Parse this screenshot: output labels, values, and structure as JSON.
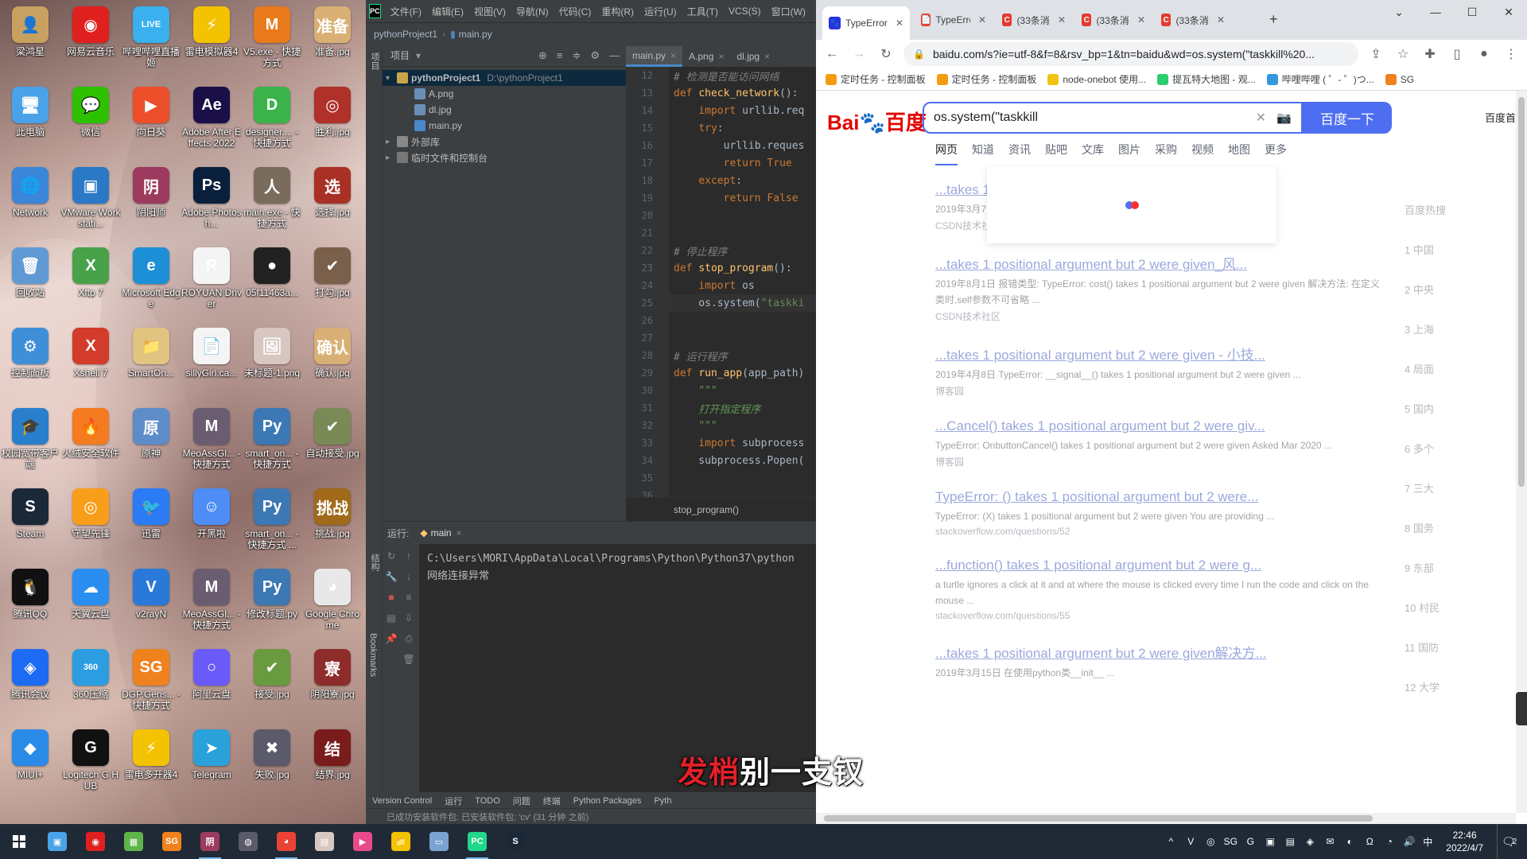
{
  "desktop": {
    "icons": [
      {
        "label": "梁鸿星",
        "color": "#c8a060",
        "glyph": "👤"
      },
      {
        "label": "网易云音乐",
        "color": "#e0201f",
        "glyph": "◉"
      },
      {
        "label": "哔哩哔哩直播姬",
        "color": "#3ab0ee",
        "glyph": "LIVE"
      },
      {
        "label": "雷电模拟器4",
        "color": "#f3c200",
        "glyph": "⚡"
      },
      {
        "label": "V5.exe - 快捷方式",
        "color": "#e87a1c",
        "glyph": "M"
      },
      {
        "label": "准备.jpg",
        "color": "#d8b076",
        "glyph": "准备"
      },
      {
        "label": "此电脑",
        "color": "#4aa3e8",
        "glyph": "🖥"
      },
      {
        "label": "微信",
        "color": "#2dc100",
        "glyph": "💬"
      },
      {
        "label": "向日葵",
        "color": "#ec4f2a",
        "glyph": "▶"
      },
      {
        "label": "Adobe After Effects 2022",
        "color": "#1b0f48",
        "glyph": "Ae"
      },
      {
        "label": "designer.... - 快捷方式",
        "color": "#3bb34a",
        "glyph": "D"
      },
      {
        "label": "胜利.jpg",
        "color": "#b0302a",
        "glyph": "◎"
      },
      {
        "label": "Network",
        "color": "#3a86d8",
        "glyph": "🌐"
      },
      {
        "label": "VMware Workstati...",
        "color": "#2b78c6",
        "glyph": "▣"
      },
      {
        "label": "阴阳师",
        "color": "#9c3b5e",
        "glyph": "阴"
      },
      {
        "label": "Adobe Photosh...",
        "color": "#0a1f3b",
        "glyph": "Ps"
      },
      {
        "label": "main.exe - 快捷方式",
        "color": "#7a6c5c",
        "glyph": "人"
      },
      {
        "label": "选择.jpg",
        "color": "#a83024",
        "glyph": "选"
      },
      {
        "label": "回收站",
        "color": "#5f9ad4",
        "glyph": "🗑"
      },
      {
        "label": "Xftp 7",
        "color": "#47a24a",
        "glyph": "X"
      },
      {
        "label": "Microsoft Edge",
        "color": "#1d8fd6",
        "glyph": "e"
      },
      {
        "label": "ROYUAN Driver",
        "color": "#f4f4f4",
        "glyph": "R"
      },
      {
        "label": "05f11463a...",
        "color": "#222222",
        "glyph": "●"
      },
      {
        "label": "打勾.jpg",
        "color": "#7a5f4a",
        "glyph": "✔"
      },
      {
        "label": "控制面板",
        "color": "#3f8fd8",
        "glyph": "⚙"
      },
      {
        "label": "Xshell 7",
        "color": "#d33b2a",
        "glyph": "X"
      },
      {
        "label": "SmartOn...",
        "color": "#e0c480",
        "glyph": "📁"
      },
      {
        "label": "sillyGirl.ca...",
        "color": "#f4f4f4",
        "glyph": "📄"
      },
      {
        "label": "未标题-1.png",
        "color": "#d7c7c0",
        "glyph": "🖼"
      },
      {
        "label": "确认.jpg",
        "color": "#d8b076",
        "glyph": "确认"
      },
      {
        "label": "校园宽带客户端",
        "color": "#2a7fcc",
        "glyph": "🎓"
      },
      {
        "label": "火绒安全软件",
        "color": "#f47b20",
        "glyph": "🔥"
      },
      {
        "label": "原神",
        "color": "#5d8cc9",
        "glyph": "原"
      },
      {
        "label": "MeoAssGl... - 快捷方式",
        "color": "#6a5d72",
        "glyph": "M"
      },
      {
        "label": "smart_on... - 快捷方式",
        "color": "#3c78b4",
        "glyph": "Py"
      },
      {
        "label": "自动接受.jpg",
        "color": "#7a8a56",
        "glyph": "✔"
      },
      {
        "label": "Steam",
        "color": "#1b2838",
        "glyph": "S"
      },
      {
        "label": "守望先锋",
        "color": "#f99e1a",
        "glyph": "◎"
      },
      {
        "label": "迅雷",
        "color": "#2b7bf5",
        "glyph": "🐦"
      },
      {
        "label": "开黑啦",
        "color": "#4e8df5",
        "glyph": "☺"
      },
      {
        "label": "smart_on... - 快捷方式 ...",
        "color": "#3c78b4",
        "glyph": "Py"
      },
      {
        "label": "挑战.jpg",
        "color": "#a06a1a",
        "glyph": "挑战"
      },
      {
        "label": "腾讯QQ",
        "color": "#111111",
        "glyph": "🐧"
      },
      {
        "label": "天翼云盘",
        "color": "#2a8ef0",
        "glyph": "☁"
      },
      {
        "label": "v2rayN",
        "color": "#2a78d8",
        "glyph": "V"
      },
      {
        "label": "MeoAssGl... - 快捷方式",
        "color": "#6a5d72",
        "glyph": "M"
      },
      {
        "label": "修改标题.py",
        "color": "#3c78b4",
        "glyph": "Py"
      },
      {
        "label": "Google Chrome",
        "color": "#e8e8e8",
        "glyph": "◕"
      },
      {
        "label": "腾讯会议",
        "color": "#1d6bf2",
        "glyph": "◈"
      },
      {
        "label": "360压缩",
        "color": "#2c9de0",
        "glyph": "360"
      },
      {
        "label": "DGP.Gens... - 快捷方式",
        "color": "#f0821e",
        "glyph": "SG"
      },
      {
        "label": "阿里云盘",
        "color": "#6a5af9",
        "glyph": "○"
      },
      {
        "label": "接受.jpg",
        "color": "#6a9a40",
        "glyph": "✔"
      },
      {
        "label": "阴阳寮.jpg",
        "color": "#8e2c2c",
        "glyph": "寮"
      },
      {
        "label": "MIUI+",
        "color": "#2a8ae8",
        "glyph": "◆"
      },
      {
        "label": "Logitech G HUB",
        "color": "#111111",
        "glyph": "G"
      },
      {
        "label": "雷电多开器4",
        "color": "#f3c200",
        "glyph": "⚡"
      },
      {
        "label": "Telegram",
        "color": "#2aa1da",
        "glyph": "➤"
      },
      {
        "label": "失败.jpg",
        "color": "#5a5a6a",
        "glyph": "✖"
      },
      {
        "label": "结界.jpg",
        "color": "#7a1c1c",
        "glyph": "结"
      }
    ]
  },
  "ide": {
    "menu": [
      "文件(F)",
      "编辑(E)",
      "视图(V)",
      "导航(N)",
      "代码(C)",
      "重构(R)",
      "运行(U)",
      "工具(T)",
      "VCS(S)",
      "窗口(W)"
    ],
    "logo": "PC",
    "breadcrumb": {
      "project": "pythonProject1",
      "file": "main.py"
    },
    "left_strip": {
      "project": "项目",
      "structure": "结构",
      "bookmarks": "Bookmarks"
    },
    "project_panel": {
      "title": "项目",
      "root": "pythonProject1",
      "root_path": "D:\\pythonProject1",
      "files": [
        "A.png",
        "dl.jpg",
        "main.py"
      ],
      "external": "外部库",
      "scratches": "临时文件和控制台"
    },
    "editor_tabs": [
      "main.py",
      "A.png",
      "dl.jpg"
    ],
    "code_lines": [
      {
        "n": "12",
        "html": "<span class='cm'># 检测是否能访问网络</span>"
      },
      {
        "n": "13",
        "html": "<span class='k'>def</span> <span class='fn'>check_network</span>():"
      },
      {
        "n": "14",
        "html": "    <span class='k'>import</span> urllib.req"
      },
      {
        "n": "15",
        "html": "    <span class='k'>try</span>:"
      },
      {
        "n": "16",
        "html": "        urllib.reques"
      },
      {
        "n": "17",
        "html": "        <span class='k'>return</span> <span class='k'>True</span>"
      },
      {
        "n": "18",
        "html": "    <span class='k'>except</span>:"
      },
      {
        "n": "19",
        "html": "        <span class='k'>return</span> <span class='k'>False</span>"
      },
      {
        "n": "20",
        "html": ""
      },
      {
        "n": "21",
        "html": ""
      },
      {
        "n": "22",
        "html": "<span class='cm'># 停止程序</span>"
      },
      {
        "n": "23",
        "html": "<span class='k'>def</span> <span class='fn'>stop_program</span>():"
      },
      {
        "n": "24",
        "html": "    <span class='k'>import</span> os"
      },
      {
        "n": "25",
        "html": "    os.system(<span class='st'>\"taskki</span>"
      },
      {
        "n": "26",
        "html": ""
      },
      {
        "n": "27",
        "html": ""
      },
      {
        "n": "28",
        "html": "<span class='cm'># 运行程序</span>"
      },
      {
        "n": "29",
        "html": "<span class='k'>def</span> <span class='fn'>run_app</span>(app_path)"
      },
      {
        "n": "30",
        "html": "    <span class='doc'>\"\"\"</span>"
      },
      {
        "n": "31",
        "html": "    <span class='doc'>打开指定程序</span>"
      },
      {
        "n": "32",
        "html": "    <span class='doc'>\"\"\"</span>"
      },
      {
        "n": "33",
        "html": "    <span class='k'>import</span> subprocess"
      },
      {
        "n": "34",
        "html": "    subprocess.Popen("
      },
      {
        "n": "35",
        "html": ""
      },
      {
        "n": "36",
        "html": ""
      }
    ],
    "current_line": "25",
    "code_crumb": "stop_program()",
    "run": {
      "label": "运行:",
      "config": "main",
      "output": [
        "C:\\Users\\MORI\\AppData\\Local\\Programs\\Python\\Python37\\python",
        "网络连接异常"
      ]
    },
    "bottom_tools": [
      "Version Control",
      "运行",
      "TODO",
      "问题",
      "终端",
      "Python Packages",
      "Pyth"
    ],
    "status": "已成功安装软件包: 已安装软件包: 'cv' (31 分钟 之前)"
  },
  "chrome": {
    "tabs": [
      {
        "title": "TypeError:",
        "color": "#2932e1",
        "glyph": "🐾",
        "active": true
      },
      {
        "title": "TypeError:",
        "color": "#e8412c",
        "glyph": "📄",
        "active": false
      },
      {
        "title": "(33条消息",
        "color": "#e33b2e",
        "glyph": "C",
        "active": false
      },
      {
        "title": "(33条消息",
        "color": "#e33b2e",
        "glyph": "C",
        "active": false
      },
      {
        "title": "(33条消息",
        "color": "#e33b2e",
        "glyph": "C",
        "active": false
      }
    ],
    "url": "baidu.com/s?ie=utf-8&f=8&rsv_bp=1&tn=baidu&wd=os.system(\"taskkill%20...",
    "bookmarks": [
      {
        "label": "定时任务 - 控制面板",
        "color": "#f39c12"
      },
      {
        "label": "定时任务 - 控制面板",
        "color": "#f39c12"
      },
      {
        "label": "node-onebot 使用...",
        "color": "#f1c40f"
      },
      {
        "label": "提瓦特大地图 - 观...",
        "color": "#2ecc71"
      },
      {
        "label": "哔哩哔哩 ( ゜- ゜)つ...",
        "color": "#3498db"
      },
      {
        "label": "SG",
        "color": "#f0821e"
      }
    ],
    "baidu": {
      "logo_left": "Bai",
      "logo_paw": "du",
      "logo_right": "百度",
      "query": "os.system(\"taskkill",
      "search_button": "百度一下",
      "home": "百度首",
      "tabs": [
        "网页",
        "知道",
        "资讯",
        "贴吧",
        "文库",
        "图片",
        "采购",
        "视频",
        "地图",
        "更多"
      ],
      "results": [
        {
          "title": "...takes 1 positional argument but 2 were given_风...",
          "desc": "2019年3月7日 出现的错误提示的 TypeError: ...",
          "url": "CSDN技术社区"
        },
        {
          "title": "...takes 1 positional argument but 2 were given_风...",
          "desc": "2019年8月1日 报错类型: TypeError: cost() takes 1 positional argument but 2 were given 解决方法: 在定义类时,self参数不可省略 ...",
          "url": "CSDN技术社区"
        },
        {
          "title": "...takes 1 positional argument but 2 were given - 小技...",
          "desc": "2019年4月8日 TypeError: __signal__() takes 1 positional argument but 2 were given ...",
          "url": "博客园"
        },
        {
          "title": "...Cancel() takes 1 positional argument but 2 were giv...",
          "desc": "TypeError: OnbuttonCancel() takes 1 positional argument but 2 were given Asked Mar 2020 ...",
          "url": "博客园"
        },
        {
          "title": "TypeError: () takes 1 positional argument but 2 were...",
          "desc": "TypeError: (X) takes 1 positional argument but 2 were given You are providing ...",
          "url": "stackoverflow.com/questions/52"
        },
        {
          "title": "...function() takes 1 positional argument but 2 were g...",
          "desc": "a turtle ignores a click at it and at where the mouse is clicked every time I run the code and click on the mouse ...",
          "url": "stackoverflow.com/questions/55"
        },
        {
          "title": "...takes 1 positional argument but 2 were given解决方...",
          "desc": "2019年3月15日 在使用python类__init__ ...",
          "url": ""
        }
      ],
      "side": [
        "百度热搜",
        "1 中国",
        "2 中央",
        "3 上海",
        "4 局面",
        "5 国内",
        "6 多个",
        "7 三大",
        "8 国务",
        "9 东部",
        "10 村民",
        "11 国防",
        "12 大学"
      ]
    }
  },
  "subtitle": {
    "red_part": "发梢",
    "white_part": "别一支钗"
  },
  "taskbar": {
    "apps": [
      {
        "name": "network-client",
        "color": "#4aa3e8",
        "glyph": "▣",
        "open": false
      },
      {
        "name": "netease-music",
        "color": "#e0201f",
        "glyph": "◉",
        "open": false
      },
      {
        "name": "app-store",
        "color": "#5fb54a",
        "glyph": "▦",
        "open": false
      },
      {
        "name": "sg",
        "color": "#f0821e",
        "glyph": "SG",
        "open": false
      },
      {
        "name": "onmyoji",
        "color": "#9c3b5e",
        "glyph": "阴",
        "open": true
      },
      {
        "name": "game",
        "color": "#5a5a6a",
        "glyph": "◍",
        "open": false
      },
      {
        "name": "chrome",
        "color": "#ea4335",
        "glyph": "◕",
        "open": true
      },
      {
        "name": "image",
        "color": "#d7c7c0",
        "glyph": "▤",
        "open": false
      },
      {
        "name": "media",
        "color": "#e84a8a",
        "glyph": "▶",
        "open": false
      },
      {
        "name": "explorer",
        "color": "#f3c200",
        "glyph": "📁",
        "open": false
      },
      {
        "name": "remote",
        "color": "#7aa3d0",
        "glyph": "▭",
        "open": false
      },
      {
        "name": "pycharm",
        "color": "#21d789",
        "glyph": "PC",
        "open": true
      },
      {
        "name": "steam",
        "color": "#1b2838",
        "glyph": "S",
        "open": false
      }
    ],
    "tray_icons": [
      "^",
      "V",
      "◎",
      "SG",
      "G",
      "▣",
      "▤",
      "◈",
      "✉",
      "◐",
      "Ω",
      "◔",
      "🔊"
    ],
    "ime": "中",
    "time": "22:46",
    "date": "2022/4/7",
    "notifications": "2"
  }
}
